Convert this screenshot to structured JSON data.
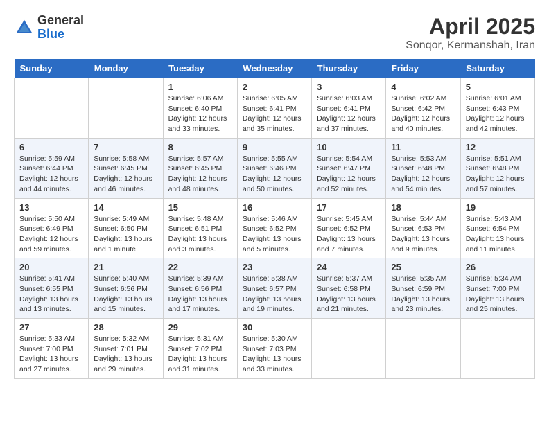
{
  "logo": {
    "general": "General",
    "blue": "Blue"
  },
  "title": "April 2025",
  "subtitle": "Sonqor, Kermanshah, Iran",
  "days_of_week": [
    "Sunday",
    "Monday",
    "Tuesday",
    "Wednesday",
    "Thursday",
    "Friday",
    "Saturday"
  ],
  "weeks": [
    [
      {
        "day": "",
        "info": ""
      },
      {
        "day": "",
        "info": ""
      },
      {
        "day": "1",
        "info": "Sunrise: 6:06 AM\nSunset: 6:40 PM\nDaylight: 12 hours and 33 minutes."
      },
      {
        "day": "2",
        "info": "Sunrise: 6:05 AM\nSunset: 6:41 PM\nDaylight: 12 hours and 35 minutes."
      },
      {
        "day": "3",
        "info": "Sunrise: 6:03 AM\nSunset: 6:41 PM\nDaylight: 12 hours and 37 minutes."
      },
      {
        "day": "4",
        "info": "Sunrise: 6:02 AM\nSunset: 6:42 PM\nDaylight: 12 hours and 40 minutes."
      },
      {
        "day": "5",
        "info": "Sunrise: 6:01 AM\nSunset: 6:43 PM\nDaylight: 12 hours and 42 minutes."
      }
    ],
    [
      {
        "day": "6",
        "info": "Sunrise: 5:59 AM\nSunset: 6:44 PM\nDaylight: 12 hours and 44 minutes."
      },
      {
        "day": "7",
        "info": "Sunrise: 5:58 AM\nSunset: 6:45 PM\nDaylight: 12 hours and 46 minutes."
      },
      {
        "day": "8",
        "info": "Sunrise: 5:57 AM\nSunset: 6:45 PM\nDaylight: 12 hours and 48 minutes."
      },
      {
        "day": "9",
        "info": "Sunrise: 5:55 AM\nSunset: 6:46 PM\nDaylight: 12 hours and 50 minutes."
      },
      {
        "day": "10",
        "info": "Sunrise: 5:54 AM\nSunset: 6:47 PM\nDaylight: 12 hours and 52 minutes."
      },
      {
        "day": "11",
        "info": "Sunrise: 5:53 AM\nSunset: 6:48 PM\nDaylight: 12 hours and 54 minutes."
      },
      {
        "day": "12",
        "info": "Sunrise: 5:51 AM\nSunset: 6:48 PM\nDaylight: 12 hours and 57 minutes."
      }
    ],
    [
      {
        "day": "13",
        "info": "Sunrise: 5:50 AM\nSunset: 6:49 PM\nDaylight: 12 hours and 59 minutes."
      },
      {
        "day": "14",
        "info": "Sunrise: 5:49 AM\nSunset: 6:50 PM\nDaylight: 13 hours and 1 minute."
      },
      {
        "day": "15",
        "info": "Sunrise: 5:48 AM\nSunset: 6:51 PM\nDaylight: 13 hours and 3 minutes."
      },
      {
        "day": "16",
        "info": "Sunrise: 5:46 AM\nSunset: 6:52 PM\nDaylight: 13 hours and 5 minutes."
      },
      {
        "day": "17",
        "info": "Sunrise: 5:45 AM\nSunset: 6:52 PM\nDaylight: 13 hours and 7 minutes."
      },
      {
        "day": "18",
        "info": "Sunrise: 5:44 AM\nSunset: 6:53 PM\nDaylight: 13 hours and 9 minutes."
      },
      {
        "day": "19",
        "info": "Sunrise: 5:43 AM\nSunset: 6:54 PM\nDaylight: 13 hours and 11 minutes."
      }
    ],
    [
      {
        "day": "20",
        "info": "Sunrise: 5:41 AM\nSunset: 6:55 PM\nDaylight: 13 hours and 13 minutes."
      },
      {
        "day": "21",
        "info": "Sunrise: 5:40 AM\nSunset: 6:56 PM\nDaylight: 13 hours and 15 minutes."
      },
      {
        "day": "22",
        "info": "Sunrise: 5:39 AM\nSunset: 6:56 PM\nDaylight: 13 hours and 17 minutes."
      },
      {
        "day": "23",
        "info": "Sunrise: 5:38 AM\nSunset: 6:57 PM\nDaylight: 13 hours and 19 minutes."
      },
      {
        "day": "24",
        "info": "Sunrise: 5:37 AM\nSunset: 6:58 PM\nDaylight: 13 hours and 21 minutes."
      },
      {
        "day": "25",
        "info": "Sunrise: 5:35 AM\nSunset: 6:59 PM\nDaylight: 13 hours and 23 minutes."
      },
      {
        "day": "26",
        "info": "Sunrise: 5:34 AM\nSunset: 7:00 PM\nDaylight: 13 hours and 25 minutes."
      }
    ],
    [
      {
        "day": "27",
        "info": "Sunrise: 5:33 AM\nSunset: 7:00 PM\nDaylight: 13 hours and 27 minutes."
      },
      {
        "day": "28",
        "info": "Sunrise: 5:32 AM\nSunset: 7:01 PM\nDaylight: 13 hours and 29 minutes."
      },
      {
        "day": "29",
        "info": "Sunrise: 5:31 AM\nSunset: 7:02 PM\nDaylight: 13 hours and 31 minutes."
      },
      {
        "day": "30",
        "info": "Sunrise: 5:30 AM\nSunset: 7:03 PM\nDaylight: 13 hours and 33 minutes."
      },
      {
        "day": "",
        "info": ""
      },
      {
        "day": "",
        "info": ""
      },
      {
        "day": "",
        "info": ""
      }
    ]
  ]
}
